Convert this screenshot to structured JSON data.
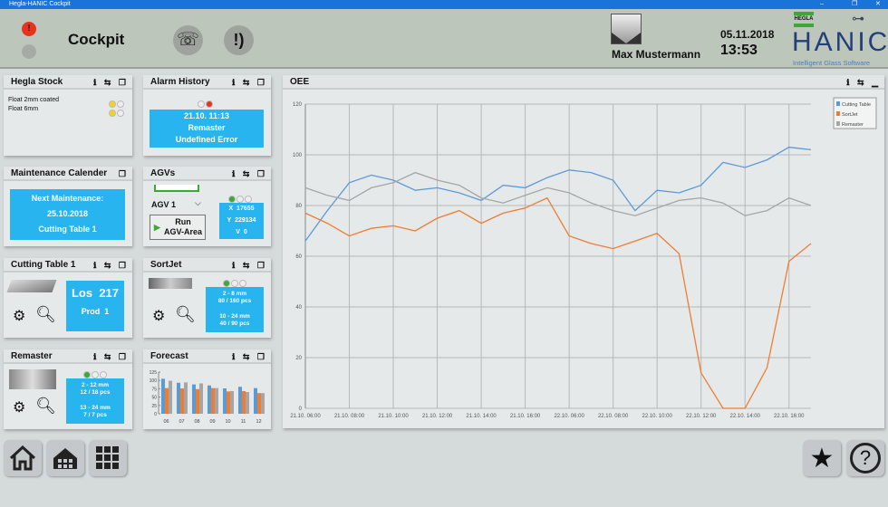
{
  "window": {
    "title": "Hegla-HANIC Cockpit",
    "controls": [
      "–",
      "❐",
      "✕"
    ]
  },
  "header": {
    "title": "Cockpit",
    "user": "Max Mustermann",
    "date": "05.11.2018",
    "time": "13:53",
    "logo_small": "HEGLA",
    "logo": "HANIC",
    "tagline": "Intelligent Glass Software"
  },
  "panels": {
    "stock": {
      "title": "Hegla Stock",
      "items": [
        {
          "label": "Float 2mm coated",
          "status": [
            "#f2d21b",
            "#eeeeee"
          ]
        },
        {
          "label": "Float 6mm",
          "status": [
            "#f2d21b",
            "#eeeeee"
          ]
        }
      ]
    },
    "alarm": {
      "title": "Alarm History",
      "time": "21.10. 11:13",
      "source": "Remaster",
      "message": "Undefined Error"
    },
    "maintenance": {
      "title": "Maintenance Calender",
      "label": "Next Maintenance:",
      "date": "25.10.2018",
      "machine": "Cutting Table 1"
    },
    "agvs": {
      "title": "AGVs",
      "selected": "AGV 1",
      "run_label_1": "Run",
      "run_label_2": "AGV-Area",
      "x_label": "X",
      "x": "17655",
      "y_label": "Y",
      "y": "229134",
      "v_label": "V",
      "v": "0"
    },
    "cutting": {
      "title": "Cutting Table 1",
      "los_label": "Los",
      "los": "217",
      "prod_label": "Prod",
      "prod": "1"
    },
    "sortjet": {
      "title": "SortJet",
      "r1": "2 - 8 mm",
      "r1v": "80 / 160 pcs",
      "r2": "10 - 24 mm",
      "r2v": "40 / 90 pcs"
    },
    "remaster": {
      "title": "Remaster",
      "r1": "2 - 12 mm",
      "r1v": "12 / 18 pcs",
      "r2": "13 - 24 mm",
      "r2v": "7 / 7 pcs"
    },
    "forecast": {
      "title": "Forecast"
    },
    "oee": {
      "title": "OEE"
    }
  },
  "colors": {
    "accent": "#27b4ef",
    "blue": "#5b9bd5",
    "orange": "#ed7d31",
    "gray": "#a5a5a5"
  },
  "chart_data": [
    {
      "type": "line",
      "title": "OEE",
      "ylim": [
        0,
        120
      ],
      "yticks": [
        0,
        20,
        40,
        60,
        80,
        100,
        120
      ],
      "grid": true,
      "legend": "top-right",
      "xticks": [
        "21.10. 06:00",
        "21.10. 08:00",
        "21.10. 10:00",
        "21.10. 12:00",
        "21.10. 14:00",
        "21.10. 16:00",
        "22.10. 06:00",
        "22.10. 08:00",
        "22.10. 10:00",
        "22.10. 12:00",
        "22.10. 14:00",
        "22.10. 16:00"
      ],
      "x": [
        "21.10. 06:00",
        "21.10. 07:00",
        "21.10. 08:00",
        "21.10. 09:00",
        "21.10. 10:00",
        "21.10. 11:00",
        "21.10. 12:00",
        "21.10. 13:00",
        "21.10. 14:00",
        "21.10. 15:00",
        "21.10. 16:00",
        "21.10. 17:00",
        "22.10. 06:00",
        "22.10. 07:00",
        "22.10. 08:00",
        "22.10. 09:00",
        "22.10. 10:00",
        "22.10. 11:00",
        "22.10. 12:00",
        "22.10. 13:00",
        "22.10. 14:00",
        "22.10. 15:00",
        "22.10. 16:00",
        "22.10. 17:00"
      ],
      "series": [
        {
          "name": "Cutting Table",
          "color": "#5b9bd5",
          "values": [
            66,
            78,
            89,
            92,
            90,
            86,
            87,
            85,
            82,
            88,
            87,
            91,
            94,
            93,
            90,
            78,
            86,
            85,
            88,
            97,
            95,
            98,
            103,
            102
          ]
        },
        {
          "name": "SortJet",
          "color": "#ed7d31",
          "values": [
            77,
            73,
            68,
            71,
            72,
            70,
            75,
            78,
            73,
            77,
            79,
            83,
            68,
            65,
            63,
            66,
            69,
            61,
            14,
            0,
            0,
            16,
            58,
            65
          ]
        },
        {
          "name": "Remaster",
          "color": "#a5a5a5",
          "values": [
            87,
            84,
            82,
            87,
            89,
            93,
            90,
            88,
            83,
            81,
            84,
            87,
            85,
            81,
            78,
            76,
            79,
            82,
            83,
            81,
            76,
            78,
            83,
            80
          ]
        }
      ]
    },
    {
      "type": "bar",
      "title": "Forecast",
      "ylim": [
        0,
        125
      ],
      "yticks": [
        0,
        25,
        50,
        75,
        100,
        125
      ],
      "categories": [
        "06",
        "07",
        "08",
        "09",
        "10",
        "11",
        "12"
      ],
      "series": [
        {
          "color": "#5b9bd5",
          "values": [
            105,
            93,
            88,
            85,
            76,
            81,
            77
          ]
        },
        {
          "color": "#ed7d31",
          "values": [
            77,
            76,
            74,
            77,
            67,
            68,
            62
          ]
        },
        {
          "color": "#a5a5a5",
          "values": [
            99,
            94,
            91,
            77,
            68,
            65,
            62
          ]
        }
      ]
    }
  ]
}
